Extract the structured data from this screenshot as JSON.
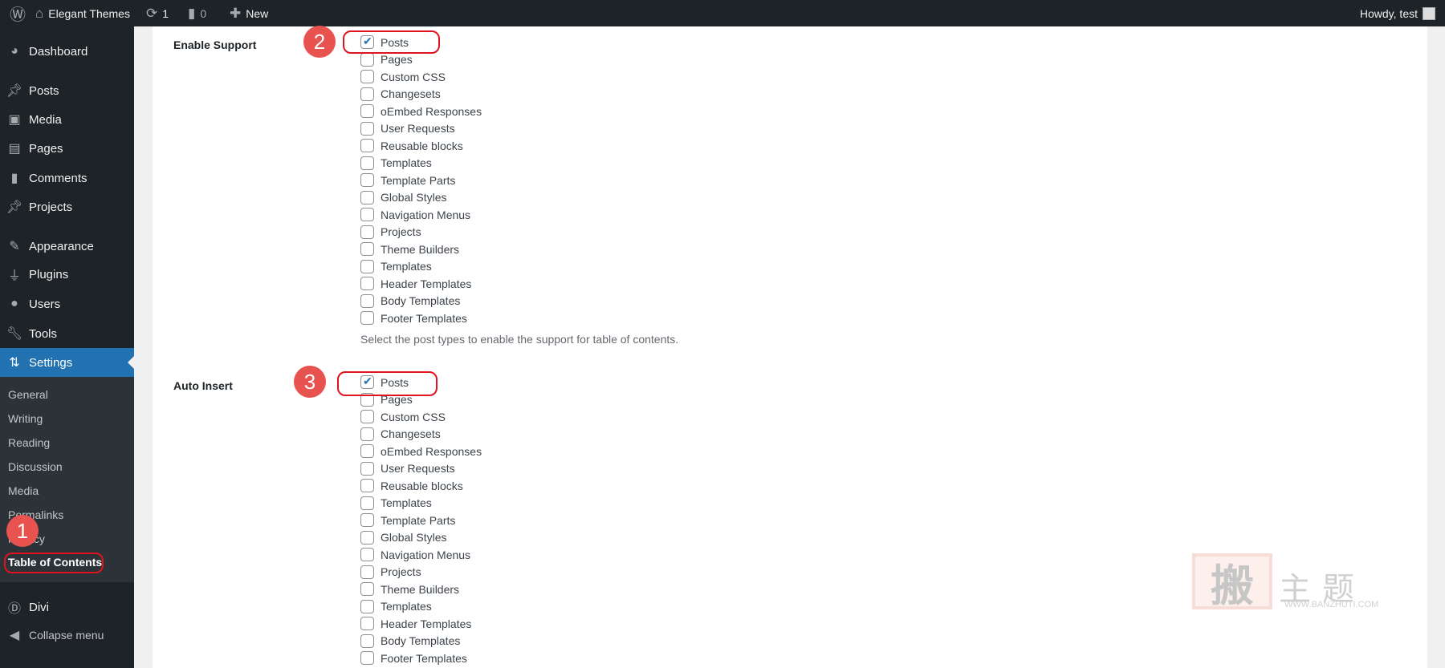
{
  "topbar": {
    "site": "Elegant Themes",
    "updates": "1",
    "comments": "0",
    "new": "New",
    "howdy": "Howdy, test"
  },
  "sidebar": {
    "items": [
      {
        "label": "Dashboard",
        "icon": "dashboard-icon"
      },
      {
        "label": "Posts",
        "icon": "pin-icon"
      },
      {
        "label": "Media",
        "icon": "media-icon"
      },
      {
        "label": "Pages",
        "icon": "pages-icon"
      },
      {
        "label": "Comments",
        "icon": "comment-icon"
      },
      {
        "label": "Projects",
        "icon": "pin-icon"
      },
      {
        "label": "Appearance",
        "icon": "brush-icon"
      },
      {
        "label": "Plugins",
        "icon": "plugin-icon"
      },
      {
        "label": "Users",
        "icon": "user-icon"
      },
      {
        "label": "Tools",
        "icon": "wrench-icon"
      },
      {
        "label": "Settings",
        "icon": "settings-icon"
      }
    ],
    "submenu": [
      "General",
      "Writing",
      "Reading",
      "Discussion",
      "Media",
      "Permalinks",
      "Privacy",
      "Table of Contents"
    ],
    "divi": "Divi",
    "collapse": "Collapse menu"
  },
  "settings": {
    "enable_support": {
      "label": "Enable Support",
      "options": [
        "Posts",
        "Pages",
        "Custom CSS",
        "Changesets",
        "oEmbed Responses",
        "User Requests",
        "Reusable blocks",
        "Templates",
        "Template Parts",
        "Global Styles",
        "Navigation Menus",
        "Projects",
        "Theme Builders",
        "Templates",
        "Header Templates",
        "Body Templates",
        "Footer Templates"
      ],
      "checked": [
        "Posts"
      ],
      "description": "Select the post types to enable the support for table of contents."
    },
    "auto_insert": {
      "label": "Auto Insert",
      "options": [
        "Posts",
        "Pages",
        "Custom CSS",
        "Changesets",
        "oEmbed Responses",
        "User Requests",
        "Reusable blocks",
        "Templates",
        "Template Parts",
        "Global Styles",
        "Navigation Menus",
        "Projects",
        "Theme Builders",
        "Templates",
        "Header Templates",
        "Body Templates",
        "Footer Templates"
      ],
      "checked": [
        "Posts"
      ]
    }
  },
  "annotations": [
    "1",
    "2",
    "3"
  ],
  "watermark": {
    "seal": "搬",
    "text": "主题",
    "url": "WWW.BANZHUTI.COM"
  },
  "colors": {
    "accent": "#2271b1",
    "annotation": "#e8534f"
  }
}
